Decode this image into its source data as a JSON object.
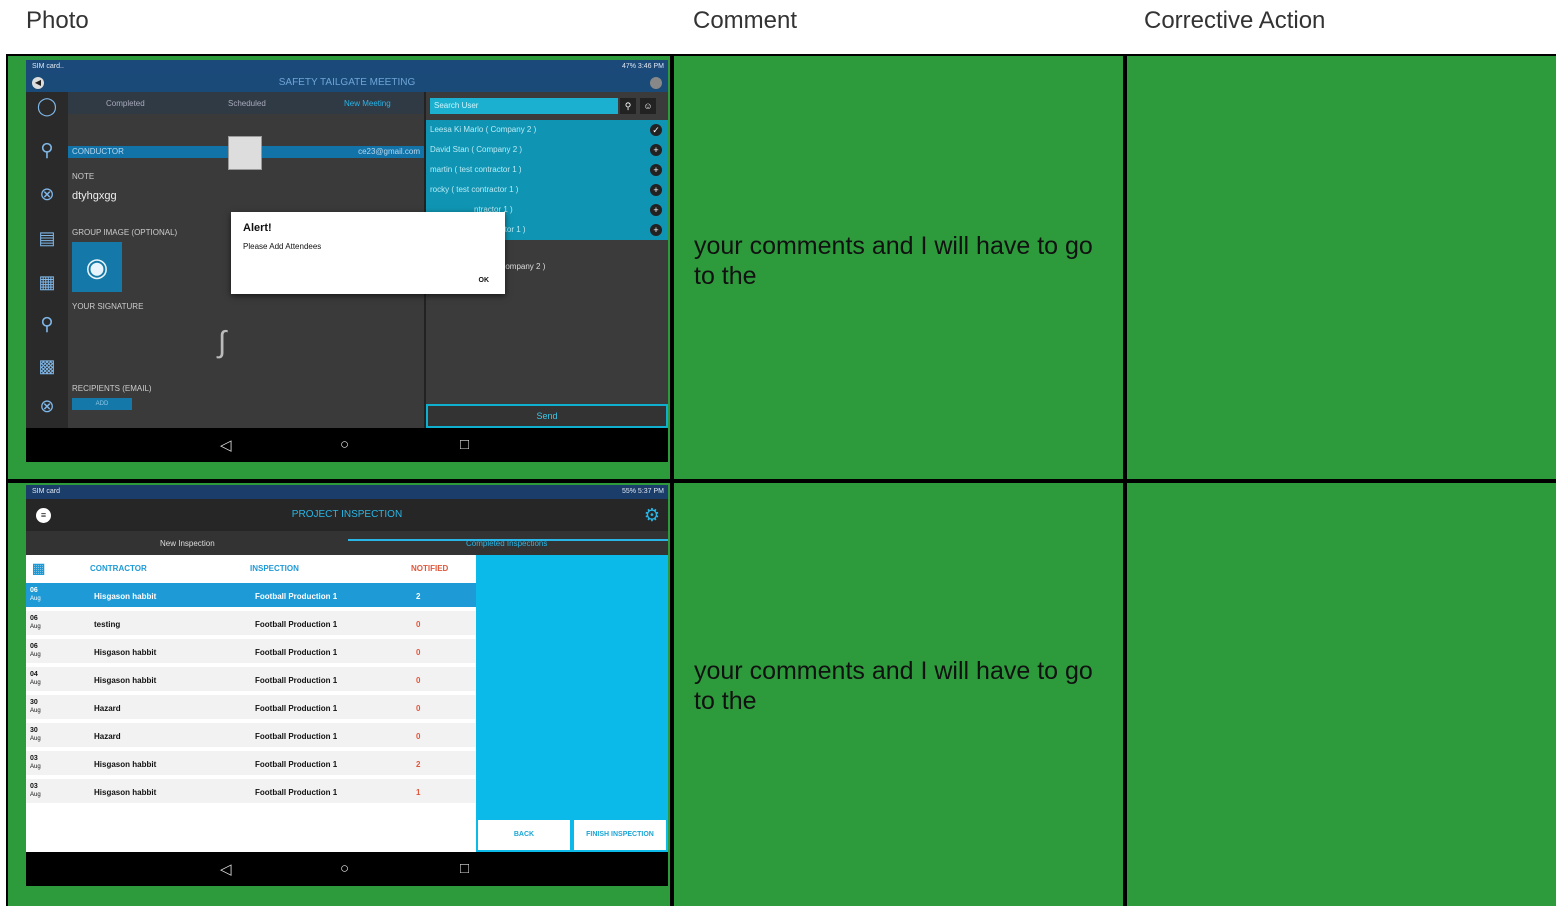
{
  "headers": {
    "photo": "Photo",
    "comment": "Comment",
    "corrective": "Corrective Action"
  },
  "colors": {
    "cell_green": "#2d9a3c",
    "accent_blue": "#1e9ad6",
    "cyan": "#0bbae8"
  },
  "rows": [
    {
      "comment": "your comments and I will have to go to the",
      "screenshot": {
        "status_left": "SIM card..",
        "status_right": "47%  3:46 PM",
        "title": "SAFETY TAILGATE MEETING",
        "tabs": [
          "Completed",
          "Scheduled",
          "New Meeting"
        ],
        "conductor_label": "CONDUCTOR",
        "conductor_email": "ce23@gmail.com",
        "note_label": "NOTE",
        "note_value": "dtyhgxgg",
        "group_image_label": "GROUP IMAGE (OPTIONAL)",
        "signature_label": "YOUR SIGNATURE",
        "recipients_label": "RECIPIENTS (EMAIL)",
        "add_label": "ADD",
        "search_placeholder": "Search User",
        "users": [
          "Leesa Ki Marlo ( Company 2 )",
          "David Stan ( Company 2 )",
          "martin ( test contractor 1 )",
          "rocky ( test contractor 1 )",
          "ntractor 1 )",
          "t contractor 1 )"
        ],
        "selected_user": "o ( Company 2 )",
        "send_label": "Send",
        "alert_title": "Alert!",
        "alert_message": "Please Add Attendees",
        "alert_ok": "OK",
        "sidebar_icons": [
          "shield-icon",
          "search-icon",
          "close-circle-icon",
          "clipboard-icon",
          "form-icon",
          "analysis-icon",
          "docs-icon",
          "reports-icon"
        ]
      }
    },
    {
      "comment": "your comments and I will have to go to the",
      "screenshot": {
        "status_left": "SIM card",
        "status_right": "55%  5:37 PM",
        "title": "PROJECT INSPECTION",
        "tabs": [
          "New Inspection",
          "Completed Inspections"
        ],
        "columns": [
          "CONTRACTOR",
          "INSPECTION",
          "NOTIFIED"
        ],
        "records": [
          {
            "day": "06",
            "mon": "Aug",
            "contractor": "Hisgason habbit",
            "inspection": "Football Production 1",
            "notified": "2",
            "selected": true
          },
          {
            "day": "06",
            "mon": "Aug",
            "contractor": "testing",
            "inspection": "Football Production 1",
            "notified": "0"
          },
          {
            "day": "06",
            "mon": "Aug",
            "contractor": "Hisgason habbit",
            "inspection": "Football Production 1",
            "notified": "0"
          },
          {
            "day": "04",
            "mon": "Aug",
            "contractor": "Hisgason habbit",
            "inspection": "Football Production 1",
            "notified": "0"
          },
          {
            "day": "30",
            "mon": "Aug",
            "contractor": "Hazard",
            "inspection": "Football Production 1",
            "notified": "0"
          },
          {
            "day": "30",
            "mon": "Aug",
            "contractor": "Hazard",
            "inspection": "Football Production 1",
            "notified": "0"
          },
          {
            "day": "03",
            "mon": "Aug",
            "contractor": "Hisgason habbit",
            "inspection": "Football Production 1",
            "notified": "2"
          },
          {
            "day": "03",
            "mon": "Aug",
            "contractor": "Hisgason habbit",
            "inspection": "Football Production 1",
            "notified": "1"
          }
        ],
        "back_label": "BACK",
        "finish_label": "FINISH INSPECTION"
      }
    }
  ]
}
